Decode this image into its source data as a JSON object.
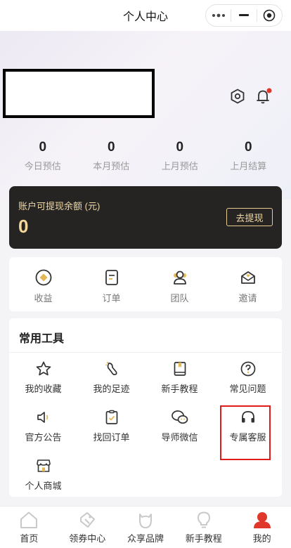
{
  "titlebar": {
    "title": "个人中心",
    "menu_icon": "more-dots-icon",
    "minimize_icon": "minimize-icon",
    "close_icon": "record-close-icon"
  },
  "header": {
    "settings_icon": "hexagon-settings-icon",
    "bell_icon": "bell-icon",
    "bell_dot_color": "#e0372b"
  },
  "stats": [
    {
      "value": "0",
      "label": "今日预估"
    },
    {
      "value": "0",
      "label": "本月预估"
    },
    {
      "value": "0",
      "label": "上月预估"
    },
    {
      "value": "0",
      "label": "上月结算"
    }
  ],
  "balance": {
    "label": "账户可提现余额 (元)",
    "amount": "0",
    "withdraw_label": "去提现"
  },
  "quick_links": [
    {
      "label": "收益",
      "icon": "earnings-icon"
    },
    {
      "label": "订单",
      "icon": "order-icon"
    },
    {
      "label": "团队",
      "icon": "team-icon"
    },
    {
      "label": "邀请",
      "icon": "invite-icon"
    }
  ],
  "tools": {
    "heading": "常用工具",
    "items": [
      {
        "label": "我的收藏",
        "icon": "star-icon"
      },
      {
        "label": "我的足迹",
        "icon": "footprint-icon"
      },
      {
        "label": "新手教程",
        "icon": "book-icon"
      },
      {
        "label": "常见问题",
        "icon": "question-icon"
      },
      {
        "label": "官方公告",
        "icon": "speaker-icon"
      },
      {
        "label": "找回订单",
        "icon": "clipboard-check-icon"
      },
      {
        "label": "导师微信",
        "icon": "wechat-icon"
      },
      {
        "label": "专属客服",
        "icon": "headset-icon"
      },
      {
        "label": "个人商城",
        "icon": "shop-icon"
      }
    ]
  },
  "tabbar": [
    {
      "label": "首页",
      "icon": "home-icon",
      "active": false
    },
    {
      "label": "领券中心",
      "icon": "coupon-icon",
      "active": false
    },
    {
      "label": "众享品牌",
      "icon": "brand-icon",
      "active": false
    },
    {
      "label": "新手教程",
      "icon": "bulb-icon",
      "active": false
    },
    {
      "label": "我的",
      "icon": "profile-icon",
      "active": true
    }
  ],
  "colors": {
    "accent": "#f3d79b",
    "active_tab": "#e0372b",
    "highlight_box": "#e01b1b"
  }
}
